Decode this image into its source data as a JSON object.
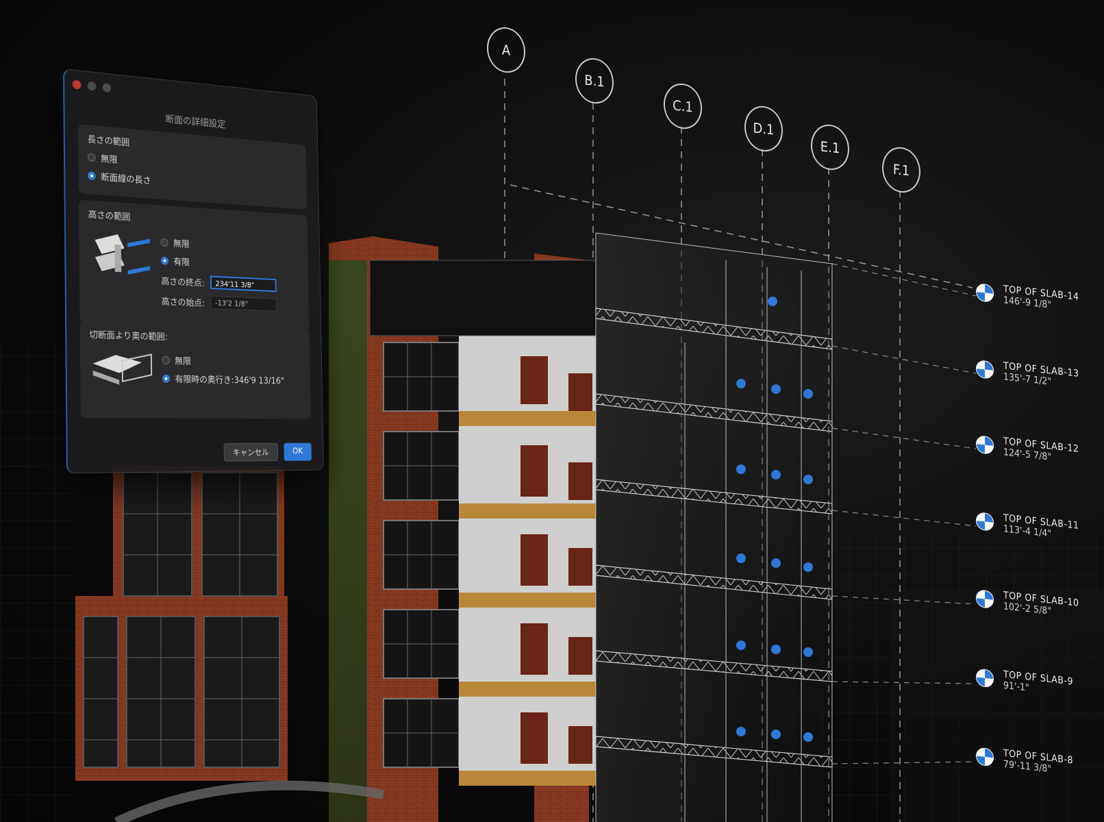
{
  "dialog": {
    "title": "断面の詳細設定",
    "help": "?",
    "length_range": {
      "heading": "長さの範囲",
      "options": [
        "無限",
        "断面線の長さ"
      ]
    },
    "height_range": {
      "heading": "高さの範囲",
      "options": [
        "無限",
        "有限"
      ],
      "end_label": "高さの終点:",
      "end_value": "234'11 3/8\"",
      "start_label": "高さの始点:",
      "start_value": "-13'2 1/8\""
    },
    "depth_range": {
      "heading": "切断面より奥の範囲:",
      "options": [
        "無限",
        "有限時の奥行き:346'9 13/16\""
      ]
    },
    "cancel_label": "キャンセル",
    "ok_label": "OK"
  },
  "grid_bubbles": [
    "A",
    "B.1",
    "C.1",
    "D.1",
    "E.1",
    "F.1"
  ],
  "levels": [
    {
      "name": "TOP OF SLAB-14",
      "elev": "146'-9 1/8\""
    },
    {
      "name": "TOP OF SLAB-13",
      "elev": "135'-7 1/2\""
    },
    {
      "name": "TOP OF SLAB-12",
      "elev": "124'-5 7/8\""
    },
    {
      "name": "TOP OF SLAB-11",
      "elev": "113'-4 1/4\""
    },
    {
      "name": "TOP OF SLAB-10",
      "elev": "102'-2 5/8\""
    },
    {
      "name": "TOP OF SLAB-9",
      "elev": "91'-1\""
    },
    {
      "name": "TOP OF SLAB-8",
      "elev": "79'-11 3/8\""
    }
  ],
  "colors": {
    "accent": "#2f78d6",
    "brick": "#8a3a22",
    "background": "#0a0a0a"
  }
}
